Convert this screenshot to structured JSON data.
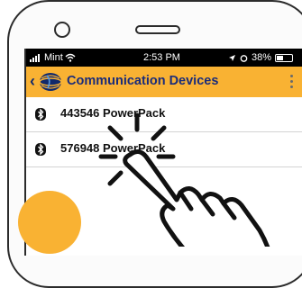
{
  "status": {
    "carrier": "Mint",
    "time": "2:53 PM",
    "battery": "38%",
    "battery_level": 0.38
  },
  "header": {
    "back_icon": "chevron-left-icon",
    "logo": "globe-logo",
    "title": "Communication Devices",
    "menu_icon": "kebab-menu-icon"
  },
  "devices": [
    {
      "icon": "bluetooth-icon",
      "label": "443546 PowerPack"
    },
    {
      "icon": "bluetooth-icon",
      "label": "576948 PowerPack"
    }
  ],
  "colors": {
    "appbar": "#f9b233",
    "title": "#1a2c7a",
    "statusbar": "#000000"
  },
  "overlay": {
    "icon": "tap-hand-icon"
  }
}
